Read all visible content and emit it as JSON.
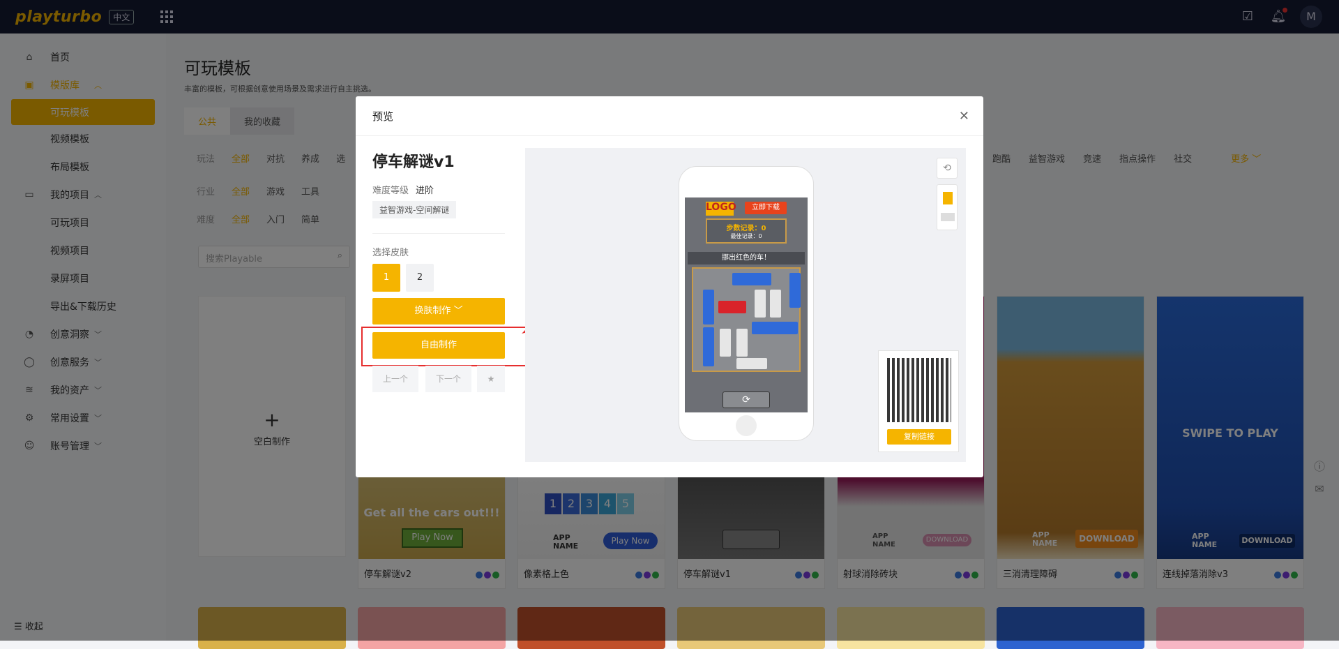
{
  "topbar": {
    "logo": "playturbo",
    "lang": "中文",
    "avatar": "M"
  },
  "sidebar": {
    "items": [
      {
        "label": "首页"
      },
      {
        "label": "模版库"
      },
      {
        "label": "可玩模板"
      },
      {
        "label": "视频模板"
      },
      {
        "label": "布局模板"
      },
      {
        "label": "我的项目"
      },
      {
        "label": "可玩项目"
      },
      {
        "label": "视频项目"
      },
      {
        "label": "录屏项目"
      },
      {
        "label": "导出&下载历史"
      },
      {
        "label": "创意洞察"
      },
      {
        "label": "创意服务"
      },
      {
        "label": "我的资产"
      },
      {
        "label": "常用设置"
      },
      {
        "label": "账号管理"
      }
    ],
    "collapse": "收起"
  },
  "main": {
    "title": "可玩模板",
    "subtitle": "丰富的模板，可根据创意使用场景及需求进行自主挑选。",
    "tabs": [
      "公共",
      "我的收藏"
    ],
    "play_label": "玩法",
    "play_opts": [
      "全部",
      "对抗",
      "养成",
      "选"
    ],
    "play_opts_right": [
      "跑酷",
      "益智游戏",
      "竞速",
      "指点操作",
      "社交"
    ],
    "more": "更多",
    "industry_label": "行业",
    "industry_opts": [
      "全部",
      "游戏",
      "工具"
    ],
    "diff_label": "难度",
    "diff_opts": [
      "全部",
      "入门",
      "简单"
    ],
    "search_placeholder": "搜索Playable",
    "blank": "空白制作",
    "cards": [
      {
        "name": "停车解谜v2",
        "caption": "Get all the cars out!!!",
        "button": "Play Now"
      },
      {
        "name": "像素格上色",
        "caption": "APP NAME",
        "button": "Play Now"
      },
      {
        "name": "停车解谜v1",
        "caption": "",
        "button": ""
      },
      {
        "name": "射球消除砖块",
        "caption": "APP NAME",
        "button": "DOWNLOAD"
      },
      {
        "name": "三消清理障碍",
        "caption": "APP NAME",
        "button": "DOWNLOAD"
      },
      {
        "name": "连线掉落消除v3",
        "caption": "APP NAME",
        "button": "DOWNLOAD"
      }
    ]
  },
  "modal": {
    "title": "预览",
    "template_name": "停车解谜v1",
    "level_label": "难度等级",
    "level_value": "进阶",
    "tag": "益智游戏-空间解谜",
    "skin_label": "选择皮肤",
    "skins": [
      "1",
      "2"
    ],
    "skin_make": "换肤制作",
    "free_make": "自由制作",
    "prev": "上一个",
    "next": "下一个",
    "copy_link": "复制链接",
    "game_banner": "挪出红色的车！",
    "game_download": "立即下载",
    "game_steps": "步数记录：0",
    "game_best": "最佳记录：0"
  },
  "colors": {
    "accent": "#f5b400",
    "topbar": "#141b33",
    "highlight": "#e62e2e"
  }
}
